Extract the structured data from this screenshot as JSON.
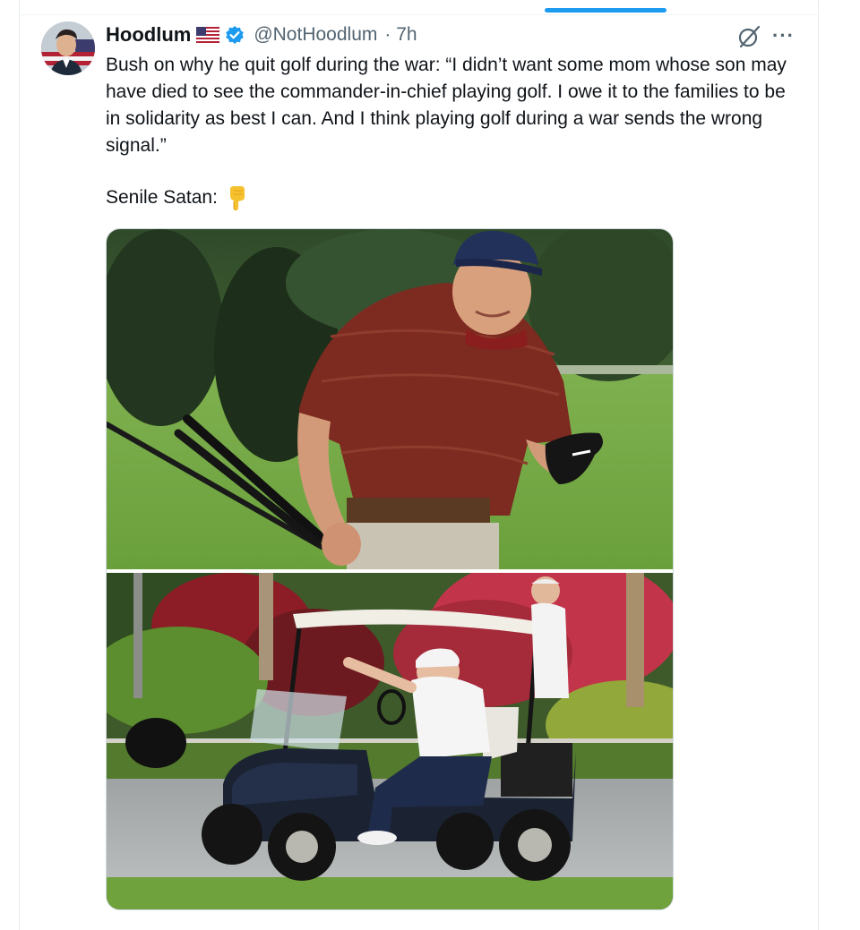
{
  "tweet": {
    "author": {
      "name": "Hoodlum",
      "handle": "@NotHoodlum",
      "time": "· 7h"
    },
    "text": "Bush on why he quit golf during the war: “I didn’t want some mom whose son may have died to see the commander-in-chief playing golf. I owe it to the families to be in solidarity as best I can. And I think playing golf during a war sends the wrong signal.”",
    "second_line": "Senile Satan:",
    "emoji": "down-pointing-hand",
    "media": {
      "photos": [
        "golfer-in-red-polo-with-clubs",
        "golf-cart-on-course"
      ]
    }
  },
  "icons": {
    "flag": "us-flag-icon",
    "verified": "verified-badge-icon",
    "grok": "grok-icon",
    "more": "more-options-icon"
  },
  "colors": {
    "accent": "#1d9bf0",
    "text": "#0f1419",
    "muted": "#536471"
  }
}
